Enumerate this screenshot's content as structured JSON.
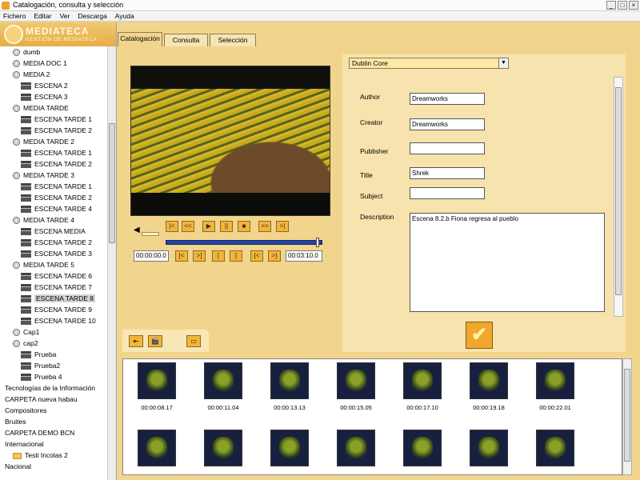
{
  "window": {
    "title": "Catalogación, consulta y selección",
    "controls": [
      "_",
      "□",
      "×"
    ]
  },
  "menu": [
    "Fichero",
    "Editar",
    "Ver",
    "Descarga",
    "Ayuda"
  ],
  "logo": {
    "title": "MEDIATECA",
    "subtitle": "GESTIÓN DE MEDIATECA"
  },
  "tree": [
    {
      "label": "dumb",
      "icon": "disc",
      "indent": 1
    },
    {
      "label": "MEDIA DOC 1",
      "icon": "disc",
      "indent": 1
    },
    {
      "label": "MEDIA 2",
      "icon": "disc",
      "indent": 1
    },
    {
      "label": "ESCENA 2",
      "icon": "clap",
      "indent": 2
    },
    {
      "label": "ESCENA 3",
      "icon": "clap",
      "indent": 2
    },
    {
      "label": "MEDIA TARDE",
      "icon": "disc",
      "indent": 1
    },
    {
      "label": "ESCENA TARDE 1",
      "icon": "clap",
      "indent": 2
    },
    {
      "label": "ESCENA TARDE 2",
      "icon": "clap",
      "indent": 2
    },
    {
      "label": "MEDIA TARDE 2",
      "icon": "disc",
      "indent": 1
    },
    {
      "label": "ESCENA TARDE 1",
      "icon": "clap",
      "indent": 2
    },
    {
      "label": "ESCENA TARDE 2",
      "icon": "clap",
      "indent": 2
    },
    {
      "label": "MEDIA TARDE 3",
      "icon": "disc",
      "indent": 1
    },
    {
      "label": "ESCENA TARDE 1",
      "icon": "clap",
      "indent": 2
    },
    {
      "label": "ESCENA TARDE 2",
      "icon": "clap",
      "indent": 2
    },
    {
      "label": "ESCENA TARDE 4",
      "icon": "clap",
      "indent": 2
    },
    {
      "label": "MEDIA TARDE 4",
      "icon": "disc",
      "indent": 1
    },
    {
      "label": "ESCENA MEDIA",
      "icon": "clap",
      "indent": 2
    },
    {
      "label": "ESCENA TARDE 2",
      "icon": "clap",
      "indent": 2
    },
    {
      "label": "ESCENA TARDE 3",
      "icon": "clap",
      "indent": 2
    },
    {
      "label": "MEDIA TARDE 5",
      "icon": "disc",
      "indent": 1
    },
    {
      "label": "ESCENA TARDE 6",
      "icon": "clap",
      "indent": 2
    },
    {
      "label": "ESCENA TARDE 7",
      "icon": "clap",
      "indent": 2
    },
    {
      "label": "ESCENA TARDE 8",
      "icon": "clap",
      "indent": 2,
      "selected": true
    },
    {
      "label": "ESCENA TARDE 9",
      "icon": "clap",
      "indent": 2
    },
    {
      "label": "ESCENA TARDE 10",
      "icon": "clap",
      "indent": 2
    },
    {
      "label": "Cap1",
      "icon": "disc",
      "indent": 1
    },
    {
      "label": "cap2",
      "icon": "disc",
      "indent": 1
    },
    {
      "label": "Prueba",
      "icon": "clap",
      "indent": 2
    },
    {
      "label": "Prueba2",
      "icon": "clap",
      "indent": 2
    },
    {
      "label": "Prueba 4",
      "icon": "clap",
      "indent": 2
    },
    {
      "label": "Tecnologías de la Información",
      "icon": "none",
      "indent": 0
    },
    {
      "label": "CARPETA nueva habau",
      "icon": "none",
      "indent": 0
    },
    {
      "label": "Compositores",
      "icon": "none",
      "indent": 0
    },
    {
      "label": "Bruites",
      "icon": "none",
      "indent": 0
    },
    {
      "label": "CARPETA DEMO BCN",
      "icon": "none",
      "indent": 0
    },
    {
      "label": "Internacional",
      "icon": "none",
      "indent": 0
    },
    {
      "label": "Testi Incolas 2",
      "icon": "folder",
      "indent": 1
    },
    {
      "label": "Nacional",
      "icon": "none",
      "indent": 0
    }
  ],
  "tabs": [
    "Catalogación",
    "Consulta",
    "Selección"
  ],
  "player": {
    "controls": [
      "|<",
      "<<",
      "▶",
      "||",
      "■",
      ">>",
      ">|"
    ],
    "mark_controls": [
      "[<",
      ">]",
      "[",
      "]",
      "{<",
      ">}"
    ],
    "time_start": "00:00:00.0",
    "time_end": "00:03:10.0",
    "progress": 0.98
  },
  "metadata": {
    "schema": "Dublin Core",
    "fields": [
      {
        "label": "Author",
        "value": "Dreamworks"
      },
      {
        "label": "Creator",
        "value": "Dreamworks"
      },
      {
        "label": "Publisher",
        "value": ""
      },
      {
        "label": "Title",
        "value": "Shrek"
      },
      {
        "label": "Subject",
        "value": ""
      }
    ],
    "description_label": "Description",
    "description_value": "Escena 8.2.b Fiona regresa al pueblo",
    "ok_label": "✔"
  },
  "thumb_toolbar": [
    "⇤",
    "🎬",
    "▭"
  ],
  "thumbnails": [
    "00:00:08.17",
    "00:00:11.04",
    "00:00:13.13",
    "00:00:15.05",
    "00:00:17.10",
    "00:00:19.18",
    "00:00:22.01",
    "",
    "",
    "",
    "",
    "",
    "",
    ""
  ]
}
